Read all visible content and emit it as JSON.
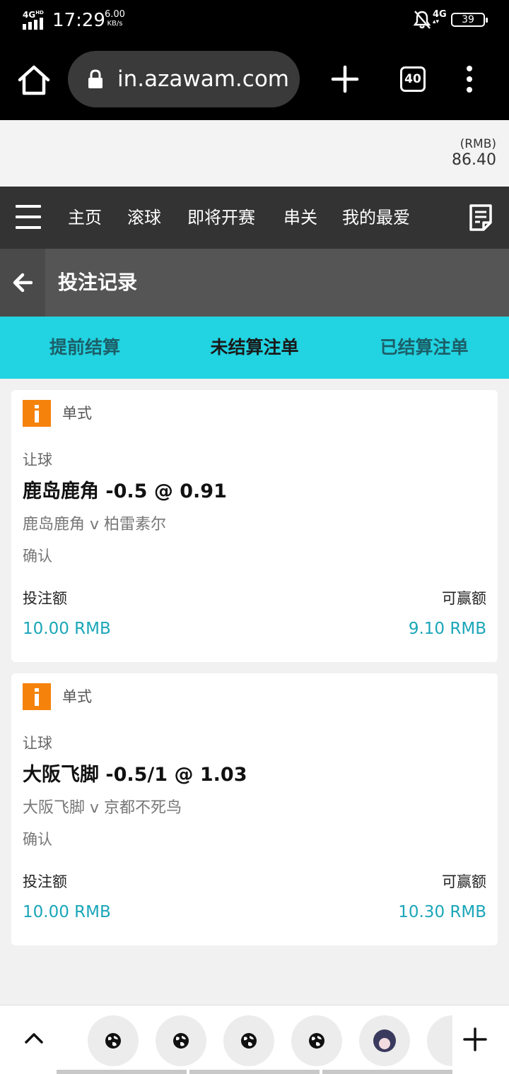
{
  "status_bar": {
    "network": "4G",
    "network_sup": "HD",
    "time": "17:29",
    "speed_value": "6.00",
    "speed_unit": "KB/s",
    "signal_right": "4G",
    "battery": "39"
  },
  "browser": {
    "url": "in.azawam.com",
    "tab_count": "40"
  },
  "balance": {
    "currency": "(RMB)",
    "amount": "86.40"
  },
  "main_nav": {
    "items": [
      "主页",
      "滚球",
      "即将开赛",
      "串关",
      "我的最爱"
    ]
  },
  "sub_header": {
    "title": "投注记录"
  },
  "tabs": [
    {
      "label": "提前结算",
      "active": false
    },
    {
      "label": "未结算注单",
      "active": true
    },
    {
      "label": "已结算注单",
      "active": false
    }
  ],
  "bets": [
    {
      "type": "单式",
      "market": "让球",
      "selection": "鹿岛鹿角 -0.5 @ 0.91",
      "match": "鹿岛鹿角 v 柏雷素尔",
      "status": "确认",
      "stake_label": "投注额",
      "stake_value": "10.00 RMB",
      "win_label": "可赢额",
      "win_value": "9.10 RMB"
    },
    {
      "type": "单式",
      "market": "让球",
      "selection": "大阪飞脚 -0.5/1 @ 1.03",
      "match": "大阪飞脚 v 京都不死鸟",
      "status": "确认",
      "stake_label": "投注额",
      "stake_value": "10.00 RMB",
      "win_label": "可赢额",
      "win_value": "10.30 RMB"
    }
  ],
  "colors": {
    "accent_cyan": "#22d3e1",
    "value_teal": "#1aa6b9",
    "info_orange": "#f5820b",
    "nav_dark": "#333333"
  }
}
